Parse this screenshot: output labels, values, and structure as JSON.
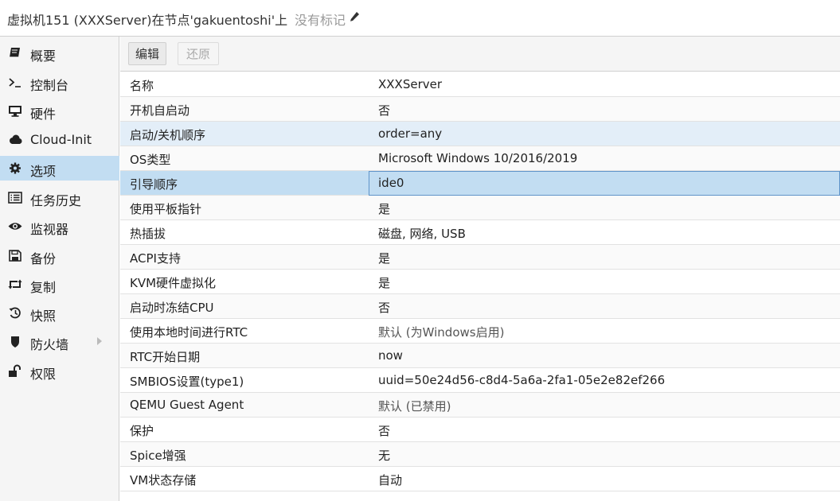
{
  "header": {
    "title": "虚拟机151 (XXXServer)在节点'gakuentoshi'上",
    "tags": "没有标记",
    "tag_icon": "pencil-icon"
  },
  "sidebar": {
    "items": [
      {
        "label": "概要",
        "icon": "book-icon"
      },
      {
        "label": "控制台",
        "icon": "terminal-icon"
      },
      {
        "label": "硬件",
        "icon": "monitor-icon"
      },
      {
        "label": "Cloud-Init",
        "icon": "cloud-icon"
      },
      {
        "label": "选项",
        "icon": "gear-icon",
        "active": true
      },
      {
        "label": "任务历史",
        "icon": "list-icon"
      },
      {
        "label": "监视器",
        "icon": "eye-icon"
      },
      {
        "label": "备份",
        "icon": "floppy-icon"
      },
      {
        "label": "复制",
        "icon": "retweet-icon"
      },
      {
        "label": "快照",
        "icon": "history-icon"
      },
      {
        "label": "防火墙",
        "icon": "shield-icon",
        "expandable": true
      },
      {
        "label": "权限",
        "icon": "unlock-icon"
      }
    ]
  },
  "toolbar": {
    "edit_label": "编辑",
    "revert_label": "还原"
  },
  "options": [
    {
      "name": "名称",
      "value": "XXXServer"
    },
    {
      "name": "开机自启动",
      "value": "否"
    },
    {
      "name": "启动/关机顺序",
      "value": "order=any",
      "state": "hover"
    },
    {
      "name": "OS类型",
      "value": "Microsoft Windows 10/2016/2019"
    },
    {
      "name": "引导顺序",
      "value": "ide0",
      "state": "selected"
    },
    {
      "name": "使用平板指针",
      "value": "是"
    },
    {
      "name": "热插拔",
      "value": "磁盘, 网络, USB"
    },
    {
      "name": "ACPI支持",
      "value": "是"
    },
    {
      "name": "KVM硬件虚拟化",
      "value": "是"
    },
    {
      "name": "启动时冻结CPU",
      "value": "否"
    },
    {
      "name": "使用本地时间进行RTC",
      "value": "默认 (为Windows启用)",
      "muted": true
    },
    {
      "name": "RTC开始日期",
      "value": "now"
    },
    {
      "name": "SMBIOS设置(type1)",
      "value": "uuid=50e24d56-c8d4-5a6a-2fa1-05e2e82ef266"
    },
    {
      "name": "QEMU Guest Agent",
      "value": "默认 (已禁用)",
      "muted": true
    },
    {
      "name": "保护",
      "value": "否"
    },
    {
      "name": "Spice增强",
      "value": "无"
    },
    {
      "name": "VM状态存储",
      "value": "自动"
    }
  ],
  "colors": {
    "selected_row": "#c2ddf2",
    "hover_row": "#e3eef8",
    "sidebar_bg": "#f5f5f5"
  }
}
